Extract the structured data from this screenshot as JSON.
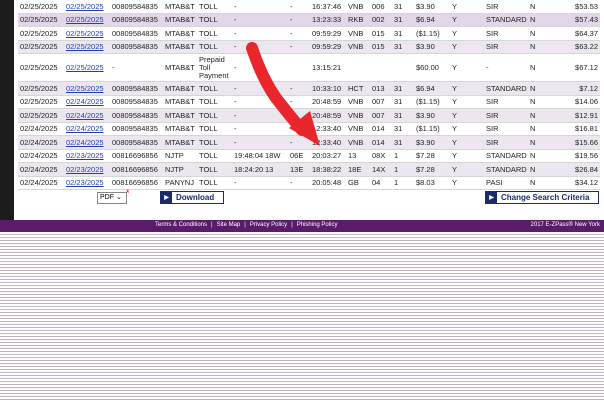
{
  "table": {
    "rows": [
      [
        "02/25/2025",
        "02/25/2025",
        "00809584835",
        "MTAB&T",
        "TOLL",
        "-",
        "",
        "-",
        "16:37:46",
        "VNB",
        "006",
        "31",
        "$3.90",
        "Y",
        "SIR",
        "N",
        "$53.53"
      ],
      [
        "02/25/2025",
        "02/25/2025",
        "00809584835",
        "MTAB&T",
        "TOLL",
        "-",
        "",
        "-",
        "13:23:33",
        "RKB",
        "002",
        "31",
        "$6.94",
        "Y",
        "STANDARD",
        "N",
        "$57.43"
      ],
      [
        "02/25/2025",
        "02/25/2025",
        "00809584835",
        "MTAB&T",
        "TOLL",
        "-",
        "",
        "-",
        "09:59:29",
        "VNB",
        "015",
        "31",
        "($1.15)",
        "Y",
        "SIR",
        "N",
        "$64.37"
      ],
      [
        "02/25/2025",
        "02/25/2025",
        "00809584835",
        "MTAB&T",
        "TOLL",
        "-",
        "",
        "-",
        "09:59:29",
        "VNB",
        "015",
        "31",
        "$3.90",
        "Y",
        "SIR",
        "N",
        "$63.22"
      ],
      [
        "02/25/2025",
        "02/25/2025",
        "-",
        "MTAB&T",
        "Prepaid Toll Payment",
        "-",
        "",
        "",
        "13:15:21",
        "",
        "",
        "",
        "$60.00",
        "Y",
        "-",
        "N",
        "$67.12"
      ],
      [
        "02/25/2025",
        "02/25/2025",
        "00809584835",
        "MTAB&T",
        "TOLL",
        "-",
        "",
        "-",
        "10:33:10",
        "HCT",
        "013",
        "31",
        "$6.94",
        "Y",
        "STANDARD",
        "N",
        "$7.12"
      ],
      [
        "02/25/2025",
        "02/24/2025",
        "00809584835",
        "MTAB&T",
        "TOLL",
        "-",
        "",
        "-",
        "20:48:59",
        "VNB",
        "007",
        "31",
        "($1.15)",
        "Y",
        "SIR",
        "N",
        "$14.06"
      ],
      [
        "02/25/2025",
        "02/24/2025",
        "00809584835",
        "MTAB&T",
        "TOLL",
        "-",
        "",
        "-",
        "20:48:59",
        "VNB",
        "007",
        "31",
        "$3.90",
        "Y",
        "SIR",
        "N",
        "$12.91"
      ],
      [
        "02/24/2025",
        "02/24/2025",
        "00809584835",
        "MTAB&T",
        "TOLL",
        "-",
        "",
        "-",
        "12:33:40",
        "VNB",
        "014",
        "31",
        "($1.15)",
        "Y",
        "SIR",
        "N",
        "$16.81"
      ],
      [
        "02/24/2025",
        "02/24/2025",
        "00809584835",
        "MTAB&T",
        "TOLL",
        "-",
        "",
        "-",
        "12:33:40",
        "VNB",
        "014",
        "31",
        "$3.90",
        "Y",
        "SIR",
        "N",
        "$15.66"
      ],
      [
        "02/24/2025",
        "02/23/2025",
        "00816696856",
        "NJTP",
        "TOLL",
        "19:48:04",
        "18W",
        "06E",
        "20:03:27",
        "13",
        "08X",
        "1",
        "$7.28",
        "Y",
        "STANDARD",
        "N",
        "$19.56"
      ],
      [
        "02/24/2025",
        "02/23/2025",
        "00816696856",
        "NJTP",
        "TOLL",
        "18:24:20",
        "13",
        "13E",
        "18:38:22",
        "18E",
        "14X",
        "1",
        "$7.28",
        "Y",
        "STANDARD",
        "N",
        "$26.84"
      ],
      [
        "02/24/2025",
        "02/23/2025",
        "00816696856",
        "PANYNJ",
        "TOLL",
        "-",
        "",
        "-",
        "20:05:48",
        "GB",
        "04",
        "1",
        "$8.03",
        "Y",
        "PASI",
        "N",
        "$34.12"
      ]
    ]
  },
  "controls": {
    "format_value": "PDF",
    "format_arrow": "⌄",
    "required_mark": "*",
    "download_label": "Download",
    "change_search_label": "Change Search Criteria"
  },
  "footer": {
    "links": [
      "Terms & Conditions",
      "Site Map",
      "Privacy Policy",
      "Phishing Policy"
    ],
    "separator": "|",
    "copyright": "2017 E-ZPass® New York"
  },
  "colors": {
    "footer_bg": "#5a1b6b",
    "link_blue": "#1f3fb3",
    "button_navy": "#1a2a6a",
    "annotation_red": "#e8262b"
  }
}
